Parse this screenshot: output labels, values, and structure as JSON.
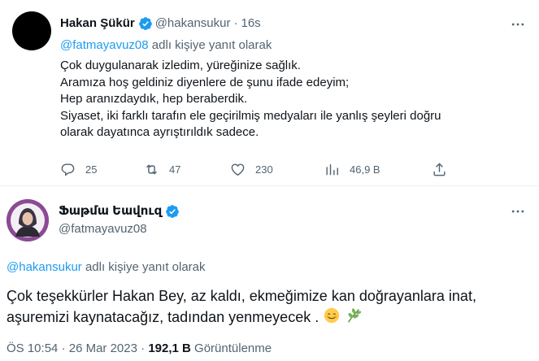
{
  "tweet1": {
    "name": "Hakan Şükür",
    "handle": "@hakansukur",
    "time": "16s",
    "replying_to": "@fatmayavuz08",
    "replying_suffix": "adlı kişiye yanıt olarak",
    "lines": [
      "Çok duygulanarak izledim, yüreğinize sağlık.",
      "Aramıza hoş geldiniz diyenlere de şunu ifade edeyim;",
      "Hep aranızdaydık, hep beraberdik.",
      "Siyaset, iki farklı tarafın ele geçirilmiş medyaları ile yanlış şeyleri doğru",
      "olarak dayatınca ayrıştırıldık sadece."
    ],
    "actions": {
      "replies": "25",
      "retweets": "47",
      "likes": "230",
      "views": "46,9 B"
    }
  },
  "tweet2": {
    "name": "Ֆաթմա Եավուզ",
    "handle": "@fatmayavuz08",
    "replying_to": "@hakansukur",
    "replying_suffix": "adlı kişiye yanıt olarak",
    "line1": "Çok teşekkürler Hakan Bey, az kaldı, ekmeğimize kan doğrayanlara inat,",
    "line2": "aşuremizi kaynatacağız, tadından yenmeyecek .",
    "time": "ÖS 10:54",
    "date": "26 Mar 2023",
    "views": "192,1 B",
    "views_label": "Görüntülenme"
  },
  "colors": {
    "accent": "#1d9bf0",
    "muted": "#536471",
    "text": "#0f1419"
  }
}
